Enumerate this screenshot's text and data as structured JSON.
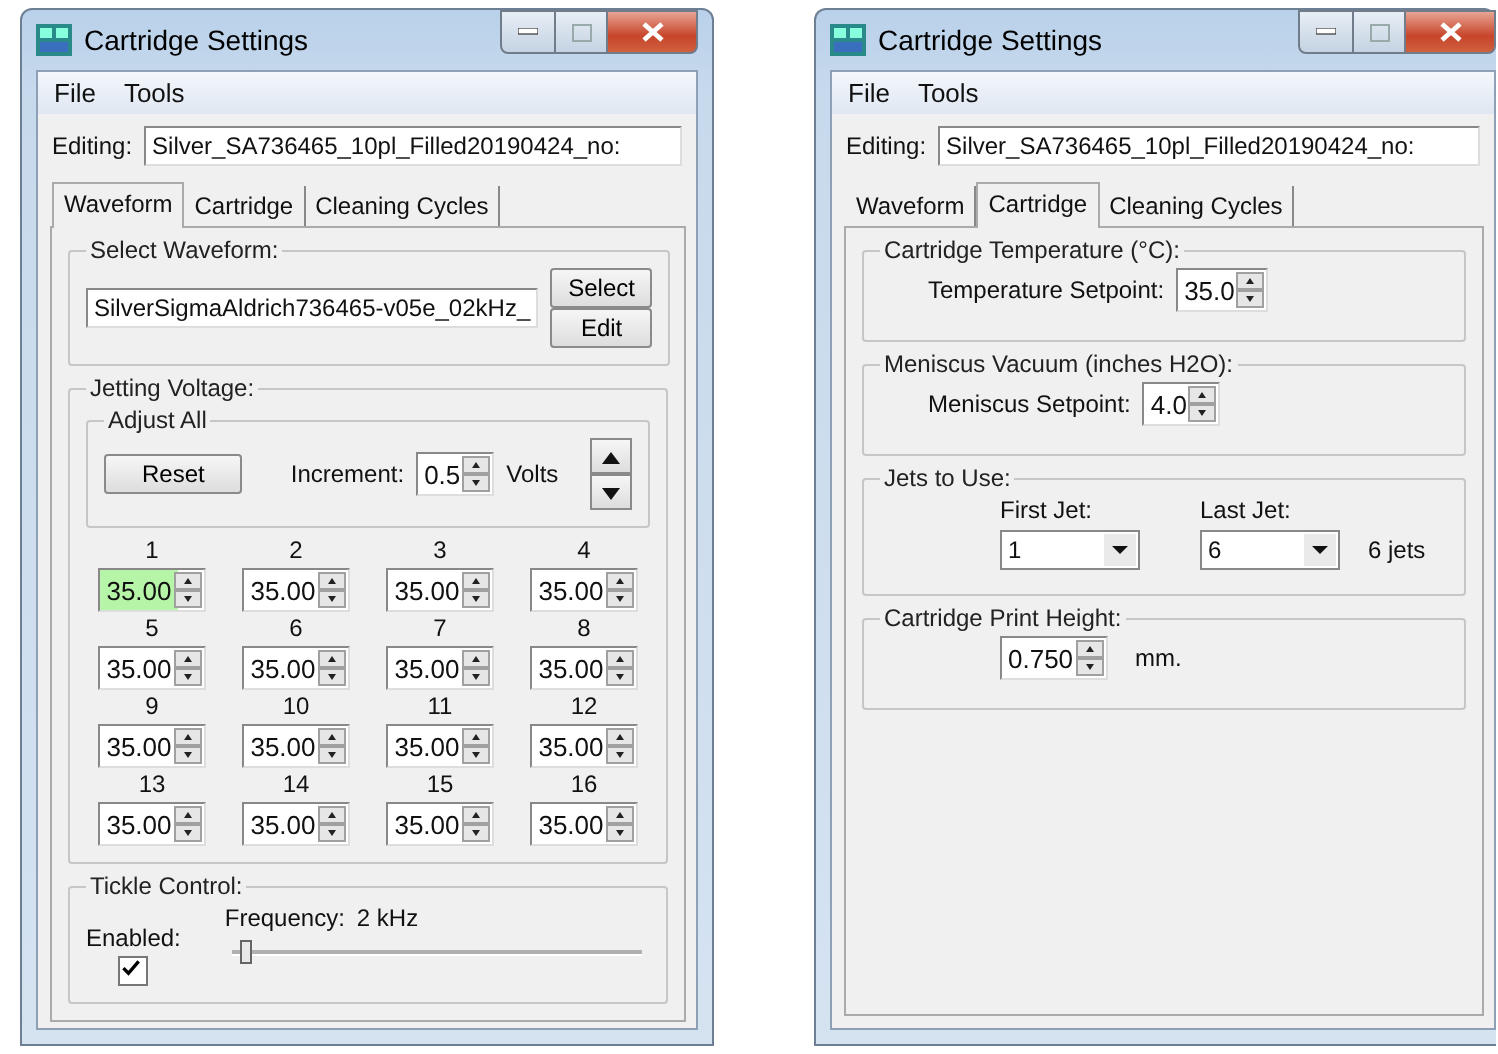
{
  "windows": [
    {
      "title": "Cartridge Settings",
      "menu": [
        "File",
        "Tools"
      ],
      "editing": {
        "label": "Editing:",
        "value": "Silver_SA736465_10pl_Filled20190424_no:"
      },
      "tabs": [
        {
          "label": "Waveform",
          "selected": true
        },
        {
          "label": "Cartridge",
          "selected": false
        },
        {
          "label": "Cleaning Cycles",
          "selected": false
        }
      ],
      "groups": [
        {
          "kind": "waveform",
          "title": "Select Waveform:",
          "value": "SilverSigmaAldrich736465-v05e_02kHz_",
          "buttons": [
            "Select",
            "Edit"
          ]
        },
        {
          "kind": "voltage",
          "title": "Jetting Voltage:",
          "adjust": {
            "title": "Adjust All",
            "reset": "Reset",
            "increment_label": "Increment:",
            "increment": "0.5",
            "unit": "Volts"
          },
          "jets": [
            {
              "label": "1",
              "value": "35.00",
              "highlighted": true
            },
            {
              "label": "2",
              "value": "35.00",
              "highlighted": false
            },
            {
              "label": "3",
              "value": "35.00",
              "highlighted": false
            },
            {
              "label": "4",
              "value": "35.00",
              "highlighted": false
            },
            {
              "label": "5",
              "value": "35.00",
              "highlighted": false
            },
            {
              "label": "6",
              "value": "35.00",
              "highlighted": false
            },
            {
              "label": "7",
              "value": "35.00",
              "highlighted": false
            },
            {
              "label": "8",
              "value": "35.00",
              "highlighted": false
            },
            {
              "label": "9",
              "value": "35.00",
              "highlighted": false
            },
            {
              "label": "10",
              "value": "35.00",
              "highlighted": false
            },
            {
              "label": "11",
              "value": "35.00",
              "highlighted": false
            },
            {
              "label": "12",
              "value": "35.00",
              "highlighted": false
            },
            {
              "label": "13",
              "value": "35.00",
              "highlighted": false
            },
            {
              "label": "14",
              "value": "35.00",
              "highlighted": false
            },
            {
              "label": "15",
              "value": "35.00",
              "highlighted": false
            },
            {
              "label": "16",
              "value": "35.00",
              "highlighted": false
            }
          ]
        },
        {
          "kind": "tickle",
          "title": "Tickle Control:",
          "enabled_label": "Enabled:",
          "enabled": true,
          "frequency_label": "Frequency:",
          "frequency": "2 kHz",
          "level": 0.02
        }
      ]
    },
    {
      "title": "Cartridge Settings",
      "menu": [
        "File",
        "Tools"
      ],
      "editing": {
        "label": "Editing:",
        "value": "Silver_SA736465_10pl_Filled20190424_no:"
      },
      "tabs": [
        {
          "label": "Waveform",
          "selected": false
        },
        {
          "label": "Cartridge",
          "selected": true
        },
        {
          "label": "Cleaning Cycles",
          "selected": false
        }
      ],
      "groups": [
        {
          "kind": "setpoint",
          "title": "Cartridge Temperature (°C):",
          "label": "Temperature Setpoint:",
          "value": "35.0"
        },
        {
          "kind": "setpoint",
          "title": "Meniscus Vacuum (inches H2O):",
          "label": "Meniscus Setpoint:",
          "value": "4.0"
        },
        {
          "kind": "jets",
          "title": "Jets to Use:",
          "first_label": "First Jet:",
          "first": "1",
          "last_label": "Last Jet:",
          "last": "6",
          "count": "6 jets"
        },
        {
          "kind": "height",
          "title": "Cartridge Print Height:",
          "value": "0.750",
          "unit": "mm."
        }
      ]
    }
  ]
}
